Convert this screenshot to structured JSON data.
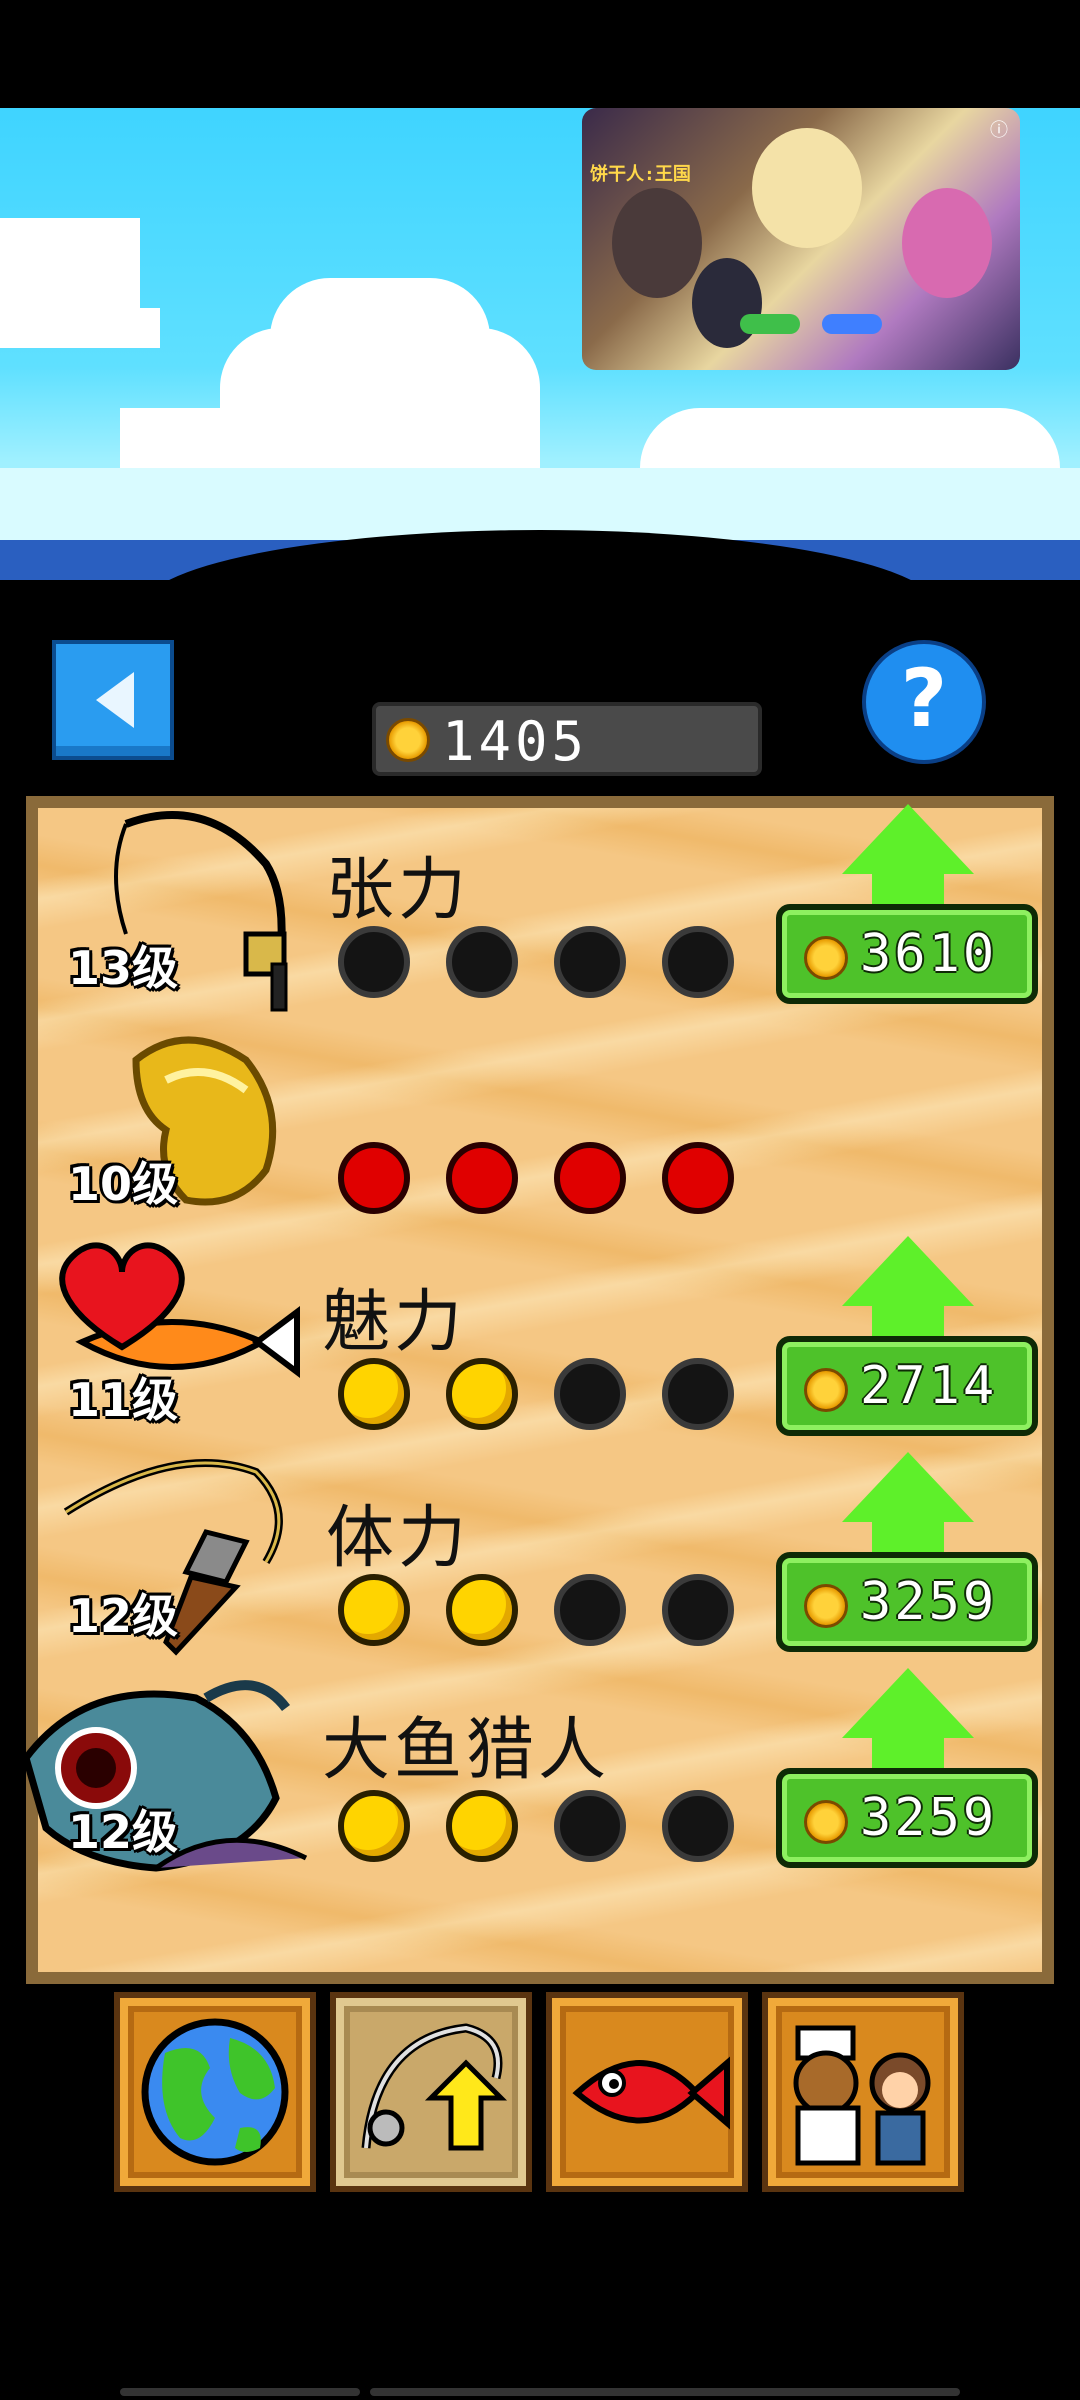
{
  "ad": {
    "title": "饼干人:王国",
    "button_left": "",
    "button_right": ""
  },
  "wallet": {
    "coins": "1405"
  },
  "rows": [
    {
      "id": "rod",
      "level": "13级",
      "label": "张力",
      "dots": [
        "off",
        "off",
        "off",
        "off"
      ],
      "cost": "3610",
      "upgradable": true
    },
    {
      "id": "glove",
      "level": "10级",
      "label": "",
      "dots": [
        "red",
        "red",
        "red",
        "red"
      ],
      "cost": "",
      "upgradable": false
    },
    {
      "id": "bait",
      "level": "11级",
      "label": "魅力",
      "dots": [
        "on",
        "on",
        "off",
        "off"
      ],
      "cost": "2714",
      "upgradable": true
    },
    {
      "id": "line",
      "level": "12级",
      "label": "体力",
      "dots": [
        "on",
        "on",
        "off",
        "off"
      ],
      "cost": "3259",
      "upgradable": true
    },
    {
      "id": "monster",
      "level": "12级",
      "label": "大鱼猎人",
      "dots": [
        "on",
        "on",
        "off",
        "off"
      ],
      "cost": "3259",
      "upgradable": true
    }
  ],
  "nav": [
    {
      "id": "world",
      "icon": "globe-icon",
      "active": false
    },
    {
      "id": "equipment",
      "icon": "rod-upgrade-icon",
      "active": true
    },
    {
      "id": "fish",
      "icon": "red-fish-icon",
      "active": false
    },
    {
      "id": "shop",
      "icon": "characters-icon",
      "active": false
    }
  ],
  "colors": {
    "sky": "#3fd4ff",
    "sand": "#f5c784",
    "upgrade": "#5ef02a",
    "coin": "#ffd23a"
  }
}
